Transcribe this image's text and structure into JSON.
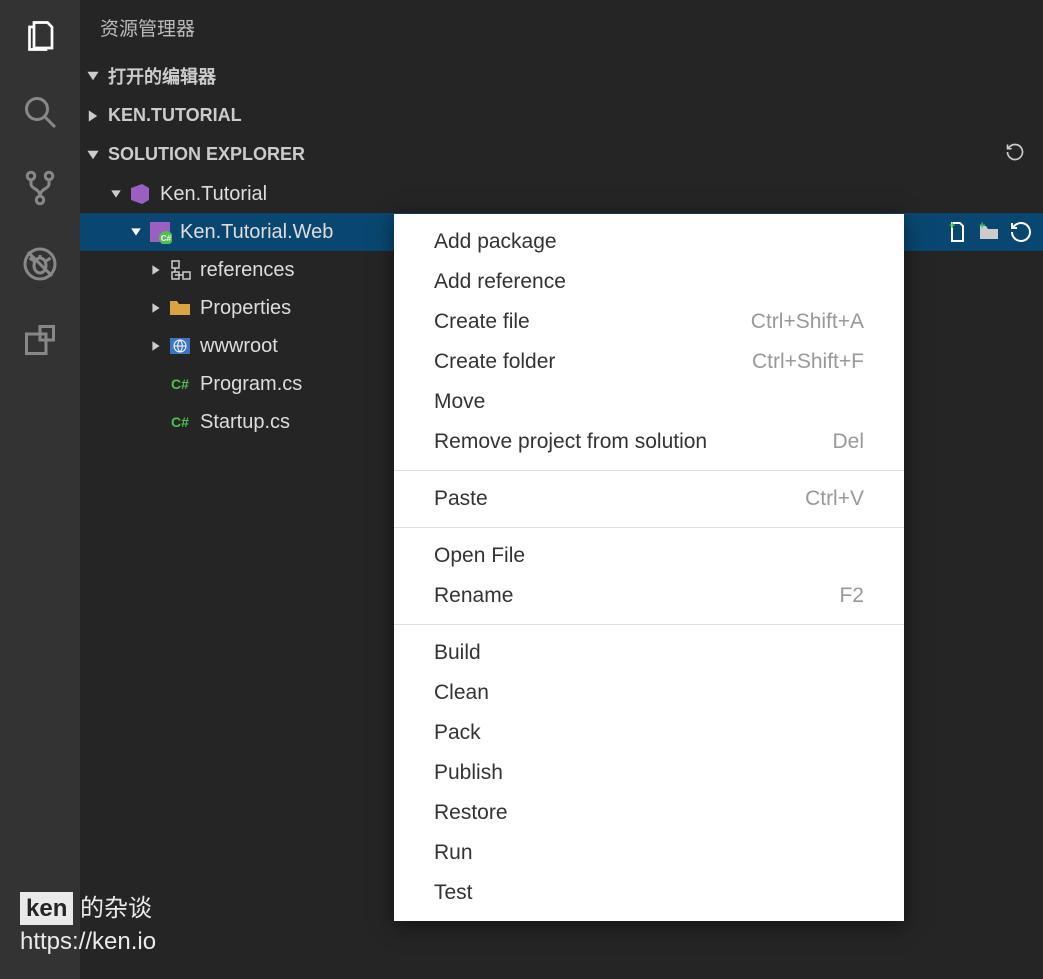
{
  "explorer": {
    "title": "资源管理器",
    "sections": {
      "openEditors": "打开的编辑器",
      "kenTutorial": "KEN.TUTORIAL",
      "solutionExplorer": "SOLUTION EXPLORER"
    }
  },
  "tree": {
    "root": "Ken.Tutorial",
    "project": "Ken.Tutorial.Web",
    "items": {
      "references": "references",
      "properties": "Properties",
      "wwwroot": "wwwroot",
      "program": "Program.cs",
      "startup": "Startup.cs"
    },
    "csBadge": "C#"
  },
  "contextMenu": {
    "addPackage": "Add package",
    "addReference": "Add reference",
    "createFile": "Create file",
    "createFileKey": "Ctrl+Shift+A",
    "createFolder": "Create folder",
    "createFolderKey": "Ctrl+Shift+F",
    "move": "Move",
    "remove": "Remove project from solution",
    "removeKey": "Del",
    "paste": "Paste",
    "pasteKey": "Ctrl+V",
    "openFile": "Open File",
    "rename": "Rename",
    "renameKey": "F2",
    "build": "Build",
    "clean": "Clean",
    "pack": "Pack",
    "publish": "Publish",
    "restore": "Restore",
    "run": "Run",
    "test": "Test"
  },
  "watermark": {
    "tag": "ken",
    "text": "的杂谈",
    "url": "https://ken.io"
  }
}
